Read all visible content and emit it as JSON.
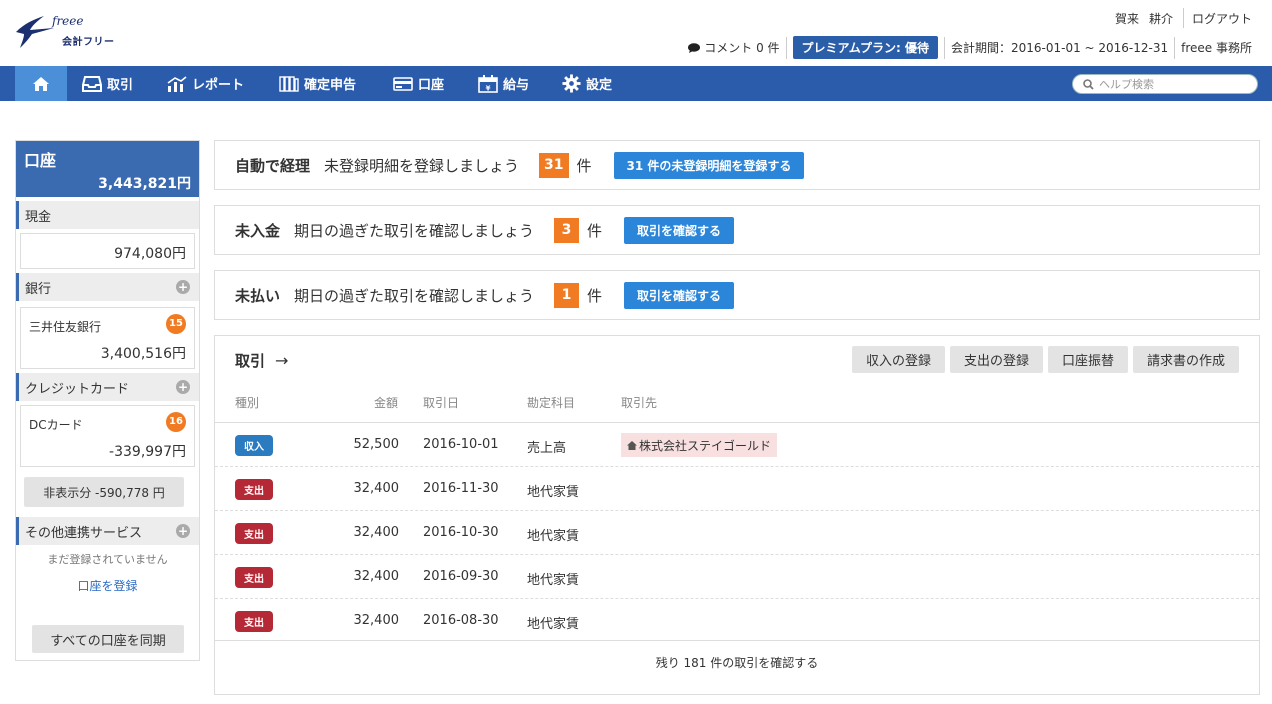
{
  "header": {
    "logo_top": "freee",
    "logo_main": "会計フリー",
    "user_last": "賀来",
    "user_first": "耕介",
    "logout": "ログアウト",
    "comment": "コメント 0 件",
    "plan": "プレミアムプラン: 優待",
    "period": "会計期間：2016-01-01 ~ 2016-12-31",
    "office": "freee 事務所"
  },
  "nav": {
    "items": [
      {
        "label": "取引"
      },
      {
        "label": "レポート"
      },
      {
        "label": "確定申告"
      },
      {
        "label": "口座"
      },
      {
        "label": "給与"
      },
      {
        "label": "設定"
      }
    ],
    "search_placeholder": "ヘルプ検索"
  },
  "sidebar": {
    "title": "口座",
    "total": "3,443,821円",
    "cash_label": "現金",
    "cash_value": "974,080円",
    "bank_label": "銀行",
    "bank_name": "三井住友銀行",
    "bank_badge": "15",
    "bank_value": "3,400,516円",
    "credit_label": "クレジットカード",
    "card_name": "DCカード",
    "card_badge": "16",
    "card_value": "-339,997円",
    "hidden": "非表示分 -590,778 円",
    "other_label": "その他連携サービス",
    "other_note": "まだ登録されていません",
    "register_link": "口座を登録",
    "sync_all": "すべての口座を同期"
  },
  "tasks": {
    "auto": {
      "title": "自動で経理",
      "desc": "未登録明細を登録しましょう",
      "count": "31",
      "unit": "件",
      "button": "31 件の未登録明細を登録する"
    },
    "unpaid_in": {
      "title": "未入金",
      "desc": "期日の過ぎた取引を確認しましょう",
      "count": "3",
      "unit": "件",
      "button": "取引を確認する"
    },
    "unpaid_out": {
      "title": "未払い",
      "desc": "期日の過ぎた取引を確認しましょう",
      "count": "1",
      "unit": "件",
      "button": "取引を確認する"
    }
  },
  "transactions": {
    "title": "取引",
    "arrow": "→",
    "buttons": [
      "収入の登録",
      "支出の登録",
      "口座振替",
      "請求書の作成"
    ],
    "columns": [
      "種別",
      "金額",
      "取引日",
      "勘定科目",
      "取引先"
    ],
    "rows": [
      {
        "type": "収入",
        "amount": "52,500",
        "date": "2016-10-01",
        "account": "売上高",
        "partner": "株式会社ステイゴールド"
      },
      {
        "type": "支出",
        "amount": "32,400",
        "date": "2016-11-30",
        "account": "地代家賃",
        "partner": ""
      },
      {
        "type": "支出",
        "amount": "32,400",
        "date": "2016-10-30",
        "account": "地代家賃",
        "partner": ""
      },
      {
        "type": "支出",
        "amount": "32,400",
        "date": "2016-09-30",
        "account": "地代家賃",
        "partner": ""
      },
      {
        "type": "支出",
        "amount": "32,400",
        "date": "2016-08-30",
        "account": "地代家賃",
        "partner": ""
      }
    ],
    "more": "残り 181 件の取引を確認する"
  },
  "colors": {
    "nav_bg": "#2b5cac",
    "home_bg": "#4a8fd8",
    "accent_orange": "#f07b22",
    "button_blue": "#2b86d9",
    "income_tag": "#2a7bc0",
    "expense_tag": "#b52835"
  },
  "icons": {
    "home": "home-icon",
    "deals": "tray-icon",
    "reports": "chart-icon",
    "tax": "books-icon",
    "accounts": "card-icon",
    "payroll": "calendar-icon",
    "settings": "gear-icon",
    "search": "search-icon",
    "comment": "speech-bubble-icon",
    "partner": "house-icon"
  }
}
